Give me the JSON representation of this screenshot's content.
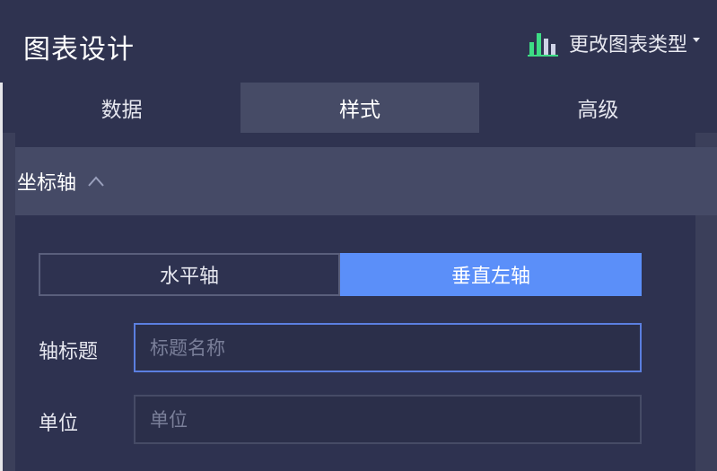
{
  "header": {
    "title": "图表设计",
    "change_type_label": "更改图表类型",
    "change_type_icon": "bar-chart-icon"
  },
  "tabs": [
    {
      "label": "数据",
      "active": false
    },
    {
      "label": "样式",
      "active": true
    },
    {
      "label": "高级",
      "active": false
    }
  ],
  "section": {
    "title": "坐标轴",
    "expanded": true,
    "toggle_icon": "chevron-up-icon"
  },
  "axis_switch": {
    "options": [
      {
        "label": "水平轴",
        "selected": false
      },
      {
        "label": "垂直左轴",
        "selected": true
      }
    ]
  },
  "fields": {
    "axis_title": {
      "label": "轴标题",
      "value": "",
      "placeholder": "标题名称"
    },
    "unit": {
      "label": "单位",
      "value": "",
      "placeholder": "单位"
    }
  },
  "colors": {
    "accent": "#5b8ff9",
    "panel_bg": "#2f3350",
    "tab_active_bg": "#464b66",
    "chart_icon_green": "#3ddc84"
  }
}
